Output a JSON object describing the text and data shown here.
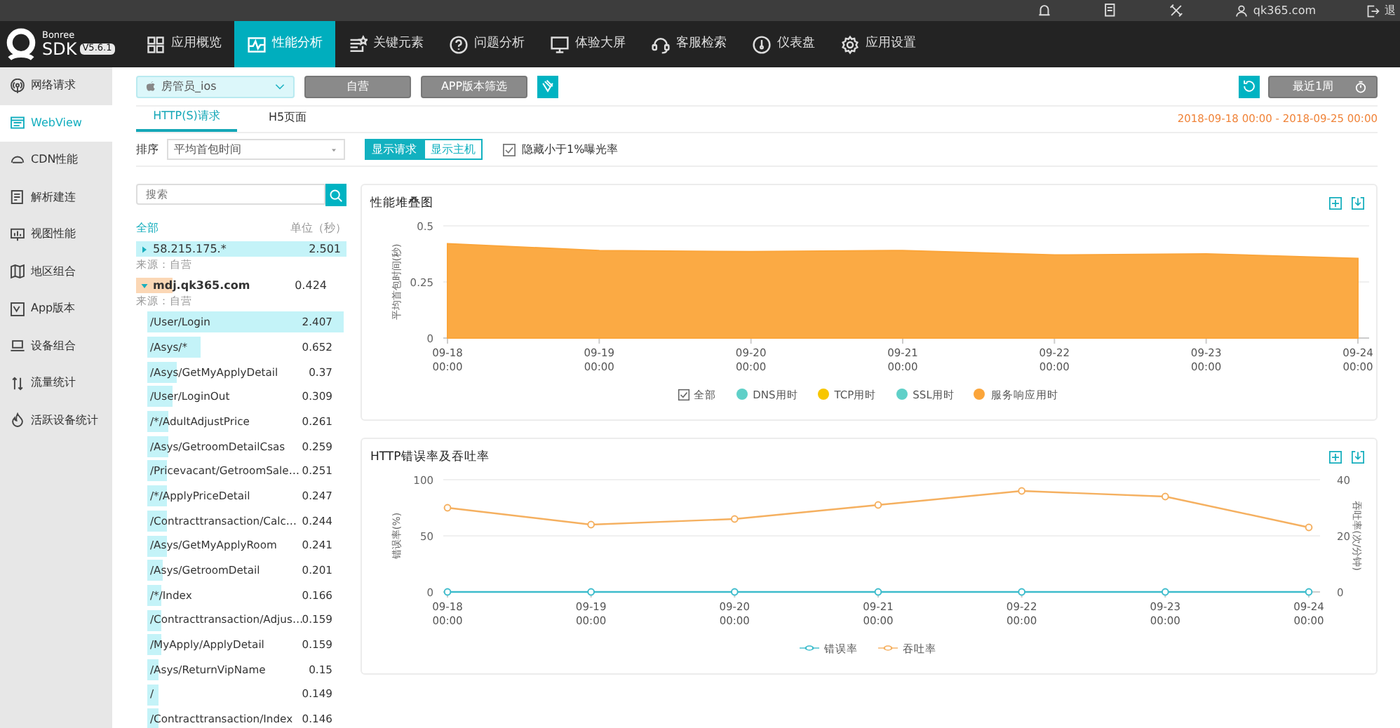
{
  "top_strip": {
    "user": "qk365.com",
    "logout": "退"
  },
  "logo": {
    "brand": "Bonree",
    "product": "SDK",
    "version": "V5.6.1"
  },
  "nav": [
    {
      "label": "应用概览",
      "selected": false
    },
    {
      "label": "性能分析",
      "selected": true
    },
    {
      "label": "关键元素",
      "selected": false
    },
    {
      "label": "问题分析",
      "selected": false
    },
    {
      "label": "体验大屏",
      "selected": false
    },
    {
      "label": "客服检索",
      "selected": false
    },
    {
      "label": "仪表盘",
      "selected": false
    },
    {
      "label": "应用设置",
      "selected": false
    }
  ],
  "sidebar": [
    {
      "label": "网络请求",
      "selected": false
    },
    {
      "label": "WebView",
      "selected": true
    },
    {
      "label": "CDN性能",
      "selected": false
    },
    {
      "label": "解析建连",
      "selected": false
    },
    {
      "label": "视图性能",
      "selected": false
    },
    {
      "label": "地区组合",
      "selected": false
    },
    {
      "label": "App版本",
      "selected": false
    },
    {
      "label": "设备组合",
      "selected": false
    },
    {
      "label": "流量统计",
      "selected": false
    },
    {
      "label": "活跃设备统计",
      "selected": false
    }
  ],
  "toolbar": {
    "app": "房管员_ios",
    "buttons": [
      "自营",
      "APP版本筛选"
    ],
    "period": "最近1周"
  },
  "tabs": [
    {
      "label": "HTTP(S)请求",
      "selected": true
    },
    {
      "label": "H5页面",
      "selected": false
    }
  ],
  "date_range": "2018-09-18 00:00 - 2018-09-25 00:00",
  "sort": {
    "label": "排序",
    "value": "平均首包时间",
    "toggles": [
      {
        "label": "显示请求",
        "selected": true
      },
      {
        "label": "显示主机",
        "selected": false
      }
    ],
    "hide_option": {
      "label": "隐藏小于1%曝光率",
      "checked": true
    }
  },
  "list": {
    "search_placeholder": "搜索",
    "all": "全部",
    "unit": "单位（秒）",
    "hosts": [
      {
        "name": "58.215.175.*",
        "value": "2.501",
        "level": 1,
        "expanded": false,
        "source": "来源：自营"
      },
      {
        "name": "mdj.qk365.com",
        "value": "0.424",
        "level": 0.17,
        "expanded": true,
        "source": "来源：自营",
        "children": [
          {
            "name": "/User/Login",
            "value": "2.407",
            "level": 1
          },
          {
            "name": "/Asys/*",
            "value": "0.652",
            "level": 0.27
          },
          {
            "name": "/Asys/GetMyApplyDetail",
            "value": "0.37",
            "level": 0.15
          },
          {
            "name": "/User/LoginOut",
            "value": "0.309",
            "level": 0.13
          },
          {
            "name": "/*/AdultAdjustPrice",
            "value": "0.261",
            "level": 0.11
          },
          {
            "name": "/Asys/GetroomDetailCsas",
            "value": "0.259",
            "level": 0.11
          },
          {
            "name": "/Pricevacant/GetroomSale…",
            "value": "0.251",
            "level": 0.1
          },
          {
            "name": "/*/ApplyPriceDetail",
            "value": "0.247",
            "level": 0.1
          },
          {
            "name": "/Contracttransaction/Calc…",
            "value": "0.244",
            "level": 0.1
          },
          {
            "name": "/Asys/GetMyApplyRoom",
            "value": "0.241",
            "level": 0.1
          },
          {
            "name": "/Asys/GetroomDetail",
            "value": "0.201",
            "level": 0.08
          },
          {
            "name": "/*/Index",
            "value": "0.166",
            "level": 0.07
          },
          {
            "name": "/Contracttransaction/Adjus…",
            "value": "0.159",
            "level": 0.07
          },
          {
            "name": "/MyApply/ApplyDetail",
            "value": "0.159",
            "level": 0.07
          },
          {
            "name": "/Asys/ReturnVipName",
            "value": "0.15",
            "level": 0.06
          },
          {
            "name": "/",
            "value": "0.149",
            "level": 0.06
          },
          {
            "name": "/Contracttransaction/Index",
            "value": "0.146",
            "level": 0.06
          }
        ]
      }
    ]
  },
  "charts": [
    {
      "title": "性能堆叠图",
      "legend_all": {
        "label": "全部",
        "checked": true
      },
      "chart_data": {
        "type": "area",
        "ylabel": "平均首包时间(秒)",
        "categories": [
          "09-18 00:00",
          "09-19 00:00",
          "09-20 00:00",
          "09-21 00:00",
          "09-22 00:00",
          "09-23 00:00",
          "09-24 00:00"
        ],
        "ylim": [
          0,
          0.5
        ],
        "yticks": [
          0,
          0.25,
          0.5
        ],
        "series": [
          {
            "name": "DNS用时",
            "color": "#5fd0c8",
            "values": [
              null,
              null,
              null,
              null,
              null,
              null,
              null
            ]
          },
          {
            "name": "TCP用时",
            "color": "#f7c600",
            "values": [
              null,
              null,
              null,
              null,
              null,
              null,
              null
            ]
          },
          {
            "name": "SSL用时",
            "color": "#5fd0c8",
            "values": [
              null,
              null,
              null,
              null,
              null,
              null,
              null
            ]
          },
          {
            "name": "服务响应用时",
            "color": "#fba53a",
            "values": [
              0.42,
              0.39,
              0.385,
              0.39,
              0.37,
              0.375,
              0.355
            ]
          }
        ]
      }
    },
    {
      "title": "HTTP错误率及吞吐率",
      "chart_data": {
        "type": "line",
        "ylabel": "错误率(%)",
        "y2label": "吞吐率(次/分钟)",
        "categories": [
          "09-18 00:00",
          "09-19 00:00",
          "09-20 00:00",
          "09-21 00:00",
          "09-22 00:00",
          "09-23 00:00",
          "09-24 00:00"
        ],
        "ylim": [
          0,
          100
        ],
        "yticks": [
          0,
          50,
          100
        ],
        "y2lim": [
          0,
          40
        ],
        "y2ticks": [
          0,
          20,
          40
        ],
        "series": [
          {
            "name": "错误率",
            "color": "#3dbccc",
            "marker": "circle",
            "values": [
              0,
              0,
              0,
              0,
              0,
              0,
              0
            ]
          },
          {
            "name": "吞吐率",
            "color": "#f5b060",
            "axis": "y2",
            "marker": "circle",
            "values": [
              30,
              24,
              26,
              31,
              36,
              34,
              23
            ]
          }
        ]
      }
    }
  ]
}
